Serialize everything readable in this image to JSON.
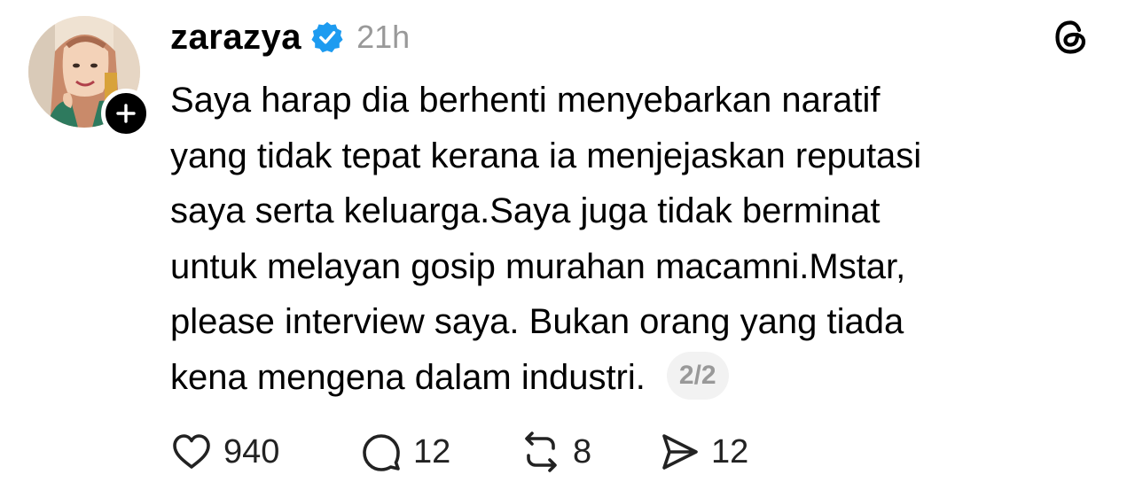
{
  "post": {
    "username": "zarazya",
    "verified": true,
    "timestamp": "21h",
    "lines": [
      "Saya harap dia berhenti menyebarkan naratif",
      "yang tidak tepat kerana ia menjejaskan reputasi",
      "saya serta keluarga.Saya juga tidak berminat",
      "untuk melayan gosip murahan macamni.Mstar,",
      "please interview saya. Bukan orang yang tiada",
      "kena mengena dalam industri."
    ],
    "pager": "2/2"
  },
  "actions": {
    "likes": "940",
    "replies": "12",
    "reposts": "8",
    "shares": "12"
  },
  "icons": {
    "verified": "verified-badge-icon",
    "follow": "plus-icon",
    "logo": "threads-logo-icon",
    "like": "heart-icon",
    "reply": "speech-bubble-icon",
    "repost": "repost-icon",
    "share": "send-icon"
  },
  "colors": {
    "verified": "#1d9bf0",
    "muted": "#999999",
    "pager_bg": "#f2f2f2"
  }
}
